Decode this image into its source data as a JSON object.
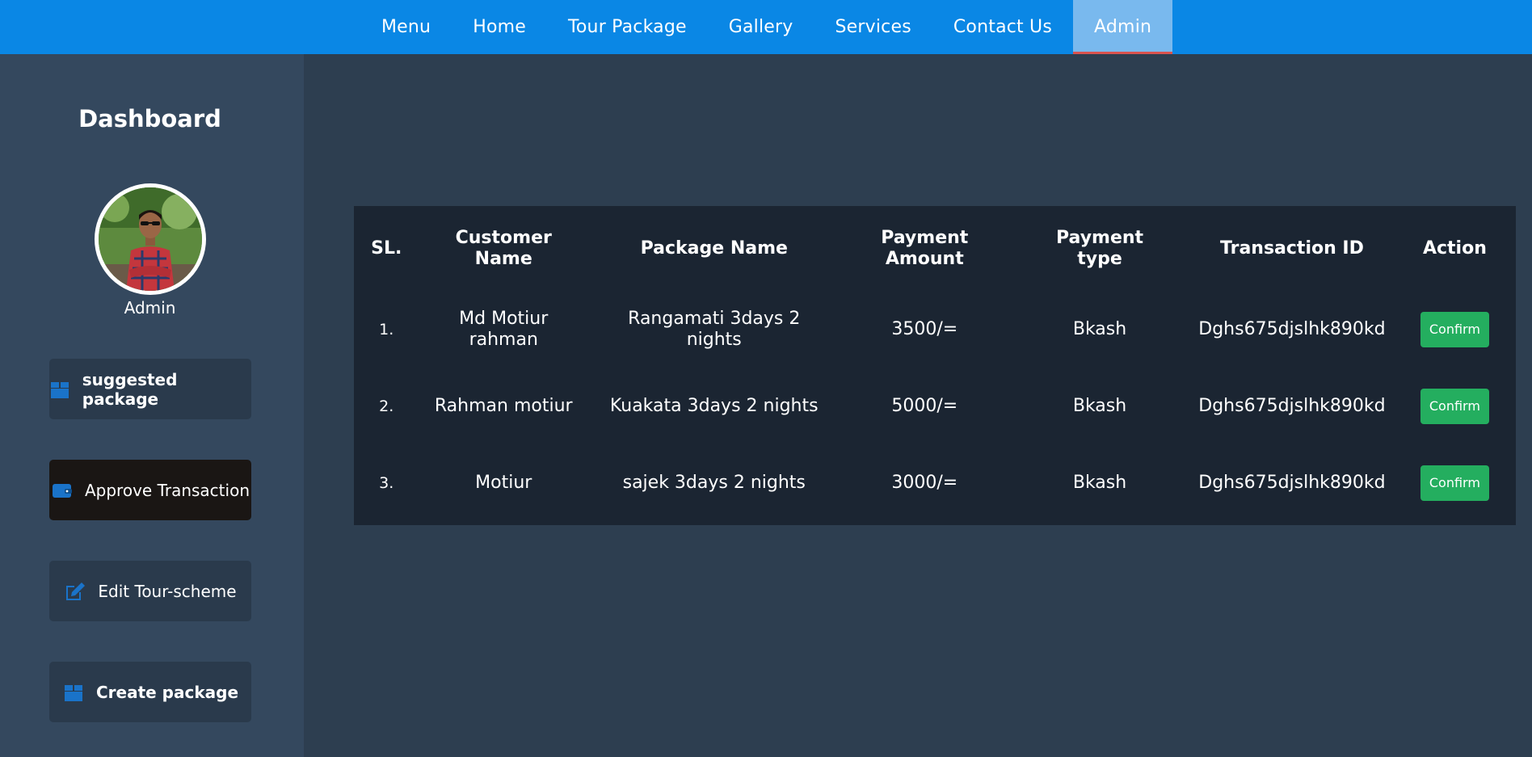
{
  "nav": {
    "items": [
      "Menu",
      "Home",
      "Tour Package",
      "Gallery",
      "Services",
      "Contact Us",
      "Admin"
    ],
    "active": "Admin"
  },
  "sidebar": {
    "title": "Dashboard",
    "user_name": "Admin",
    "buttons": [
      {
        "label": "suggested package",
        "icon": "box-icon"
      },
      {
        "label": "Approve Transaction",
        "icon": "wallet-icon"
      },
      {
        "label": "Edit Tour-scheme",
        "icon": "edit-icon"
      },
      {
        "label": "Create package",
        "icon": "box-icon"
      }
    ]
  },
  "table": {
    "headers": {
      "sl": "SL.",
      "customer": "Customer Name",
      "package": "Package Name",
      "amount": "Payment Amount",
      "type": "Payment type",
      "txn": "Transaction ID",
      "action": "Action"
    },
    "rows": [
      {
        "sl": "1.",
        "customer": "Md Motiur rahman",
        "package": "Rangamati 3days 2 nights",
        "amount": "3500/=",
        "type": "Bkash",
        "txn": "Dghs675djslhk890kd",
        "action": "Confirm"
      },
      {
        "sl": "2.",
        "customer": "Rahman motiur",
        "package": "Kuakata 3days 2 nights",
        "amount": "5000/=",
        "type": "Bkash",
        "txn": "Dghs675djslhk890kd",
        "action": "Confirm"
      },
      {
        "sl": "3.",
        "customer": "Motiur",
        "package": "sajek 3days 2 nights",
        "amount": "3000/=",
        "type": "Bkash",
        "txn": "Dghs675djslhk890kd",
        "action": "Confirm"
      }
    ]
  },
  "colors": {
    "navbar": "#0a87e5",
    "nav_active": "#79b9ee",
    "sidebar": "#34485e",
    "main": "#2d3e50",
    "table": "#1b2532",
    "confirm": "#24ae5f",
    "icon": "#1a73c9"
  }
}
